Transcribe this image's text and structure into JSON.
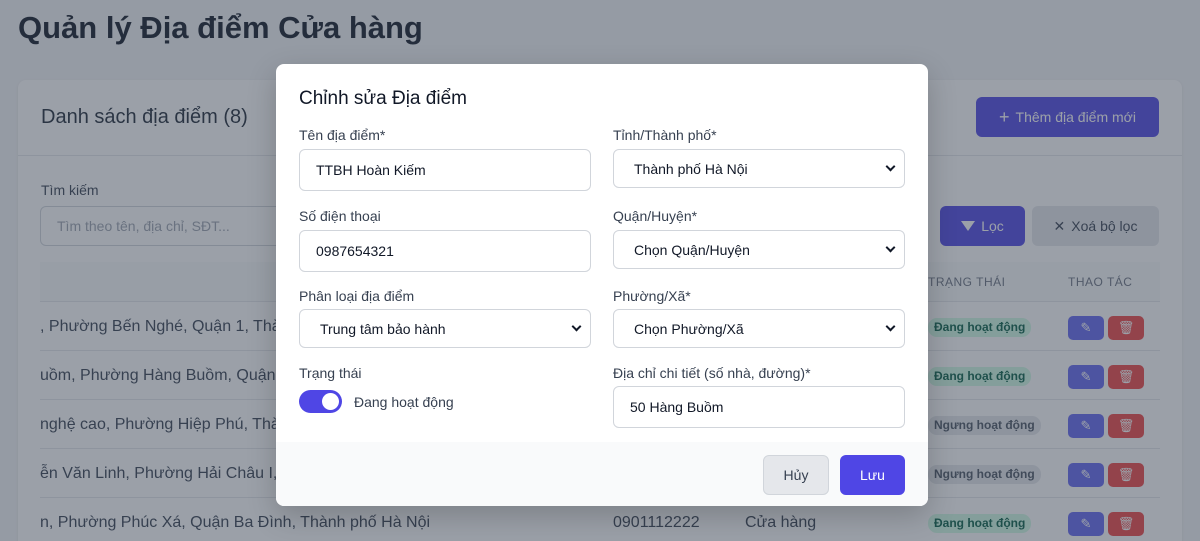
{
  "page": {
    "title": "Quản lý Địa điểm Cửa hàng"
  },
  "list": {
    "title": "Danh sách địa điểm (8)",
    "add_button": "Thêm địa điểm mới",
    "search_label": "Tìm kiếm",
    "search_placeholder": "Tìm theo tên, địa chỉ, SĐT...",
    "filter_button": "Lọc",
    "clear_button": "Xoá bộ lọc",
    "columns": {
      "status": "TRẠNG THÁI",
      "actions": "THAO TÁC"
    },
    "rows": [
      {
        "address": ", Phường Bến Nghé, Quận 1, Thà",
        "phone": "",
        "type": "",
        "status": "Đang hoạt động",
        "status_kind": "active"
      },
      {
        "address": "uồm, Phường Hàng Buồm, Quận",
        "phone": "",
        "type": "",
        "status": "Đang hoạt động",
        "status_kind": "active"
      },
      {
        "address": "nghệ cao, Phường Hiệp Phú, Thà",
        "phone": "",
        "type": "",
        "status": "Ngưng hoạt động",
        "status_kind": "inactive"
      },
      {
        "address": "ễn Văn Linh, Phường Hải Châu I,",
        "phone": "",
        "type": "",
        "status": "Ngưng hoạt động",
        "status_kind": "inactive"
      },
      {
        "address": "n, Phường Phúc Xá, Quận Ba Đình, Thành phố Hà Nội",
        "phone": "0901112222",
        "type": "Cửa hàng",
        "status": "Đang hoạt động",
        "status_kind": "active"
      }
    ]
  },
  "modal": {
    "title": "Chỉnh sửa Địa điểm",
    "name": {
      "label": "Tên địa điểm*",
      "value": "TTBH Hoàn Kiếm"
    },
    "phone": {
      "label": "Số điện thoại",
      "value": "0987654321"
    },
    "category": {
      "label": "Phân loại địa điểm",
      "value": "Trung tâm bảo hành"
    },
    "status": {
      "label": "Trạng thái",
      "toggle_label": "Đang hoạt động",
      "on": true
    },
    "province": {
      "label": "Tỉnh/Thành phố*",
      "value": "Thành phố Hà Nội"
    },
    "district": {
      "label": "Quận/Huyện*",
      "value": "Chọn Quận/Huyện"
    },
    "ward": {
      "label": "Phường/Xã*",
      "value": "Chọn Phường/Xã"
    },
    "address": {
      "label": "Địa chỉ chi tiết (số nhà, đường)*",
      "value": "50 Hàng Buồm"
    },
    "cancel_button": "Hủy",
    "save_button": "Lưu"
  },
  "colors": {
    "primary": "#4f46e5",
    "danger": "#ef4444",
    "active_badge_bg": "#d1fae5",
    "inactive_badge_bg": "#e5e7eb"
  }
}
